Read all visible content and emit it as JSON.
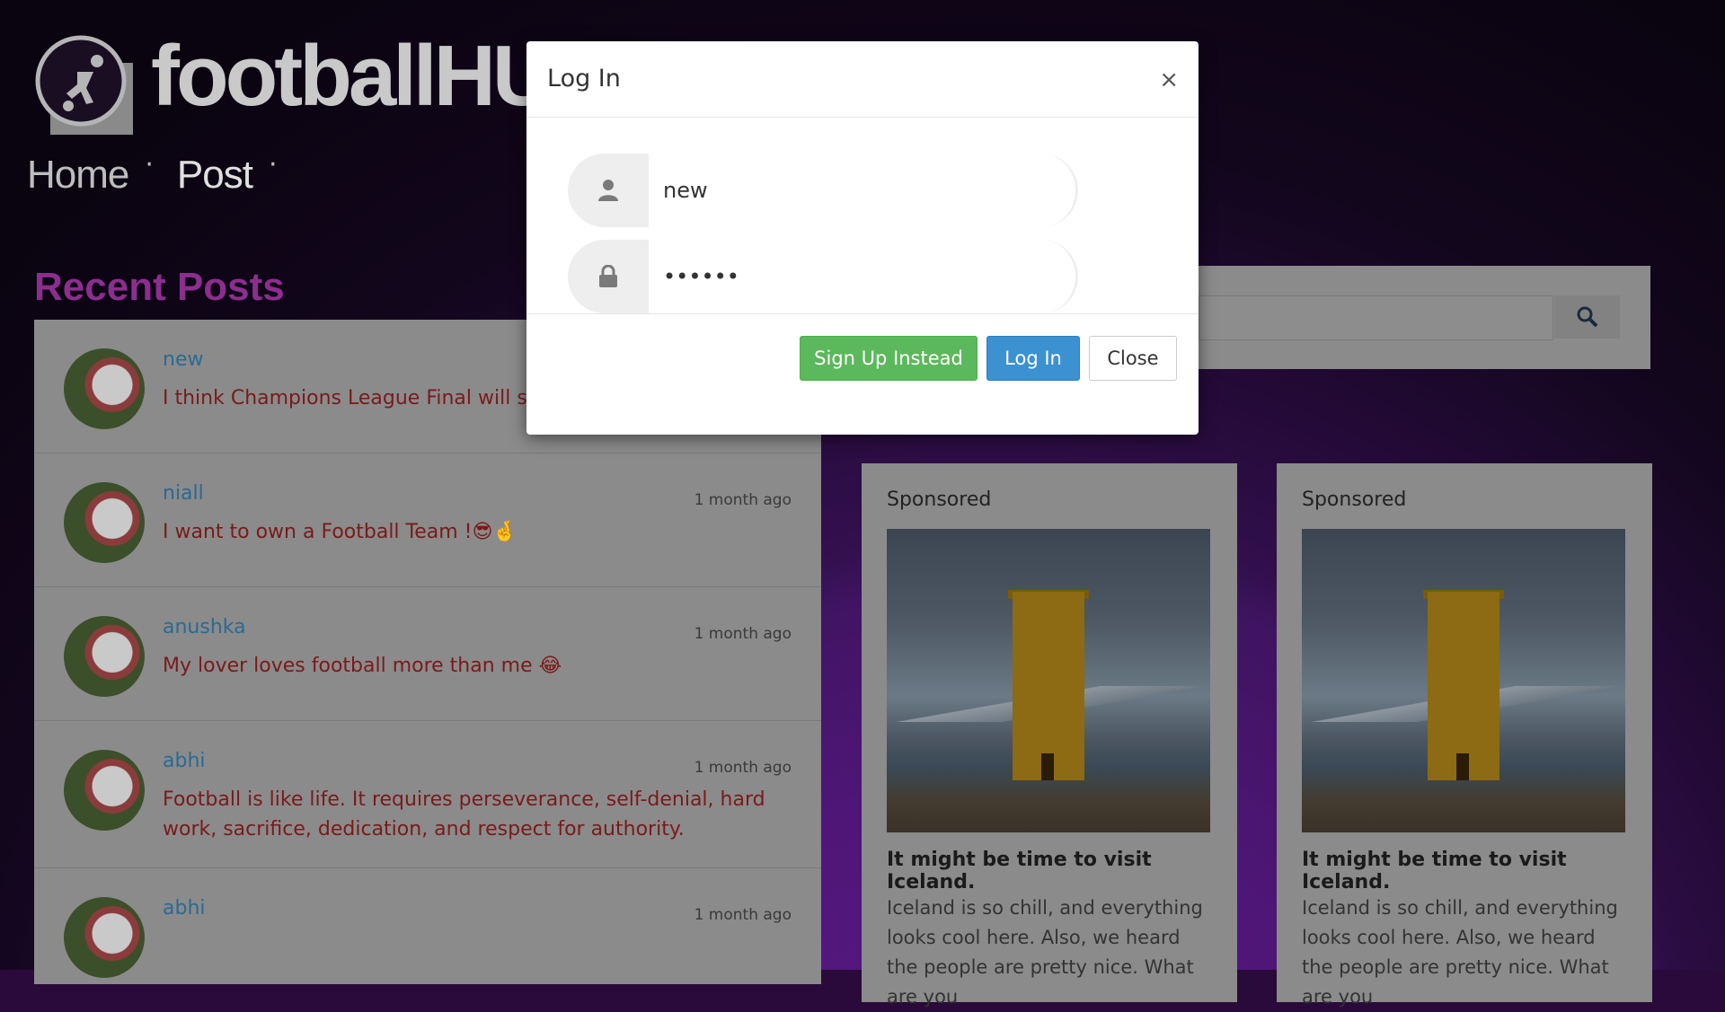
{
  "app": {
    "logo_text": "footballHUB"
  },
  "nav": {
    "items": [
      {
        "label": "Home"
      },
      {
        "label": "Post"
      }
    ],
    "separator": "·"
  },
  "recent": {
    "title": "Recent Posts",
    "posts": [
      {
        "user": "new",
        "time": "",
        "text": "I think Champions League Final will settl"
      },
      {
        "user": "niall",
        "time": "1 month ago",
        "text": "I want to own a Football Team !😎🤞"
      },
      {
        "user": "anushka",
        "time": "1 month ago",
        "text": "My lover loves football more than me 😂"
      },
      {
        "user": "abhi",
        "time": "1 month ago",
        "text": "Football is like life. It requires perseverance, self-denial, hard work, sacrifice, dedication, and respect for authority."
      },
      {
        "user": "abhi",
        "time": "1 month ago",
        "text": ""
      }
    ]
  },
  "search": {
    "icon": "search-icon"
  },
  "ads": [
    {
      "label": "Sponsored",
      "headline": "It might be time to visit Iceland.",
      "desc": "Iceland is so chill, and everything looks cool here. Also, we heard the people are pretty nice. What are you"
    },
    {
      "label": "Sponsored",
      "headline": "It might be time to visit Iceland.",
      "desc": "Iceland is so chill, and everything looks cool here. Also, we heard the people are pretty nice. What are you"
    }
  ],
  "modal": {
    "title": "Log In",
    "close_symbol": "×",
    "username_value": "new",
    "password_value": "••••••",
    "signup_label": "Sign Up Instead",
    "login_label": "Log In",
    "close_label": "Close"
  },
  "colors": {
    "accent_purple": "#8c2e8e",
    "green": "#5cb85c",
    "blue": "#3c91d0"
  }
}
